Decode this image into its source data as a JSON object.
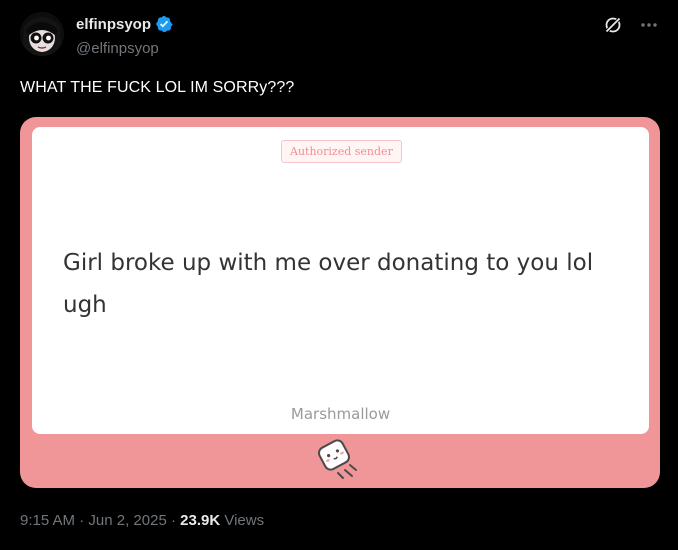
{
  "author": {
    "display_name": "elfinpsyop",
    "handle": "@elfinpsyop",
    "verified": true,
    "verified_color": "#1d9bf0"
  },
  "tweet": {
    "text": "WHAT THE FUCK LOL IM  SORRy???"
  },
  "media": {
    "background_color": "#f09598",
    "badge": "Authorized sender",
    "message": "Girl broke up with me over donating to you lol ugh",
    "signature": "Marshmallow",
    "logo_icon": "marshmallow-logo-icon"
  },
  "meta": {
    "time": "9:15 AM",
    "separator": " · ",
    "date": "Jun 2, 2025",
    "views_count": "23.9K",
    "views_label": "Views"
  },
  "icons": {
    "grok": "grok-icon",
    "more": "more-icon"
  }
}
